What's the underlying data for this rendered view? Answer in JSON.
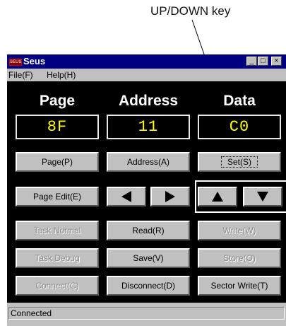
{
  "callout": {
    "label": "UP/DOWN key"
  },
  "window": {
    "title": "Seus",
    "icon_text": "SEUS",
    "controls": {
      "minimize": "_",
      "maximize": "□",
      "close": "×"
    }
  },
  "menu": {
    "file": "File(F)",
    "help": "Help(H)"
  },
  "columns": {
    "page": "Page",
    "address": "Address",
    "data": "Data"
  },
  "values": {
    "page": "8F",
    "address": "11",
    "data": "C0"
  },
  "buttons": {
    "page": "Page(P)",
    "address": "Address(A)",
    "set": "Set(S)",
    "page_edit": "Page Edit(E)",
    "task_normal": "Task Normal",
    "read": "Read(R)",
    "write": "Write(W)",
    "task_debug": "Task Debug",
    "save": "Save(V)",
    "store": "Store(O)",
    "connect": "Connect(C)",
    "disconnect": "Disconnect(D)",
    "sector_write": "Sector Write(T)"
  },
  "icons": {
    "left": "left-arrow-icon",
    "right": "right-arrow-icon",
    "up": "up-arrow-icon",
    "down": "down-arrow-icon"
  },
  "status": {
    "text": "Connected"
  },
  "colors": {
    "title_bar": "#000080",
    "panel": "#000000",
    "display_text": "#ffff00",
    "face": "#c0c0c0"
  }
}
